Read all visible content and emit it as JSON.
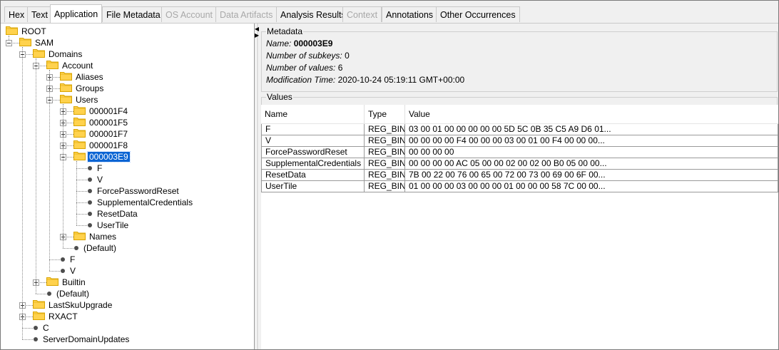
{
  "tabs": [
    {
      "label": "Hex",
      "state": "normal"
    },
    {
      "label": "Text",
      "state": "normal"
    },
    {
      "label": "Application",
      "state": "active"
    },
    {
      "label": "File Metadata",
      "state": "normal"
    },
    {
      "label": "OS Account",
      "state": "disabled"
    },
    {
      "label": "Data Artifacts",
      "state": "disabled"
    },
    {
      "label": "Analysis Results",
      "state": "normal"
    },
    {
      "label": "Context",
      "state": "disabled"
    },
    {
      "label": "Annotations",
      "state": "normal"
    },
    {
      "label": "Other Occurrences",
      "state": "normal"
    }
  ],
  "tree": [
    {
      "label": "ROOT",
      "kind": "folder",
      "depth": 0,
      "expander": "none"
    },
    {
      "label": "SAM",
      "kind": "folder",
      "depth": 1,
      "expander": "minus"
    },
    {
      "label": "Domains",
      "kind": "folder",
      "depth": 2,
      "expander": "minus"
    },
    {
      "label": "Account",
      "kind": "folder",
      "depth": 3,
      "expander": "minus"
    },
    {
      "label": "Aliases",
      "kind": "folder",
      "depth": 4,
      "expander": "plus"
    },
    {
      "label": "Groups",
      "kind": "folder",
      "depth": 4,
      "expander": "plus"
    },
    {
      "label": "Users",
      "kind": "folder",
      "depth": 4,
      "expander": "minus"
    },
    {
      "label": "000001F4",
      "kind": "folder",
      "depth": 5,
      "expander": "plus"
    },
    {
      "label": "000001F5",
      "kind": "folder",
      "depth": 5,
      "expander": "plus"
    },
    {
      "label": "000001F7",
      "kind": "folder",
      "depth": 5,
      "expander": "plus"
    },
    {
      "label": "000001F8",
      "kind": "folder",
      "depth": 5,
      "expander": "plus"
    },
    {
      "label": "000003E9",
      "kind": "folder",
      "depth": 5,
      "expander": "minus",
      "selected": true
    },
    {
      "label": "F",
      "kind": "value",
      "depth": 6
    },
    {
      "label": "V",
      "kind": "value",
      "depth": 6
    },
    {
      "label": "ForcePasswordReset",
      "kind": "value",
      "depth": 6
    },
    {
      "label": "SupplementalCredentials",
      "kind": "value",
      "depth": 6
    },
    {
      "label": "ResetData",
      "kind": "value",
      "depth": 6
    },
    {
      "label": "UserTile",
      "kind": "value",
      "depth": 6
    },
    {
      "label": "Names",
      "kind": "folder",
      "depth": 5,
      "expander": "plus"
    },
    {
      "label": "(Default)",
      "kind": "value",
      "depth": 5
    },
    {
      "label": "F",
      "kind": "value",
      "depth": 4
    },
    {
      "label": "V",
      "kind": "value",
      "depth": 4
    },
    {
      "label": "Builtin",
      "kind": "folder",
      "depth": 3,
      "expander": "plus"
    },
    {
      "label": "(Default)",
      "kind": "value",
      "depth": 3
    },
    {
      "label": "LastSkuUpgrade",
      "kind": "folder",
      "depth": 2,
      "expander": "plus"
    },
    {
      "label": "RXACT",
      "kind": "folder",
      "depth": 2,
      "expander": "plus"
    },
    {
      "label": "C",
      "kind": "value",
      "depth": 2
    },
    {
      "label": "ServerDomainUpdates",
      "kind": "value",
      "depth": 2
    }
  ],
  "metadata": {
    "title": "Metadata",
    "name_label": "Name:",
    "name_value": "000003E9",
    "subkeys_label": "Number of subkeys:",
    "subkeys_value": "0",
    "values_label": "Number of values:",
    "values_value": "6",
    "modtime_label": "Modification Time:",
    "modtime_value": "2020-10-24 05:19:11 GMT+00:00"
  },
  "values": {
    "title": "Values",
    "columns": [
      "Name",
      "Type",
      "Value"
    ],
    "rows": [
      {
        "name": "F",
        "type": "REG_BIN",
        "value": "03 00 01 00 00 00 00 00 5D 5C 0B 35 C5 A9 D6 01..."
      },
      {
        "name": "V",
        "type": "REG_BIN",
        "value": "00 00 00 00 F4 00 00 00 03 00 01 00 F4 00 00 00..."
      },
      {
        "name": "ForcePasswordReset",
        "type": "REG_BIN",
        "value": "00 00 00 00"
      },
      {
        "name": "SupplementalCredentials",
        "type": "REG_BIN",
        "value": "00 00 00 00 AC 05 00 00 02 00 02 00 B0 05 00 00..."
      },
      {
        "name": "ResetData",
        "type": "REG_BIN",
        "value": "7B 00 22 00 76 00 65 00 72 00 73 00 69 00 6F 00..."
      },
      {
        "name": "UserTile",
        "type": "REG_BIN",
        "value": "01 00 00 00 03 00 00 00 01 00 00 00 58 7C 00 00..."
      }
    ]
  },
  "colors": {
    "folder": "#ffd24d",
    "folder_edge": "#d9a400",
    "selection": "#0a64d3"
  }
}
